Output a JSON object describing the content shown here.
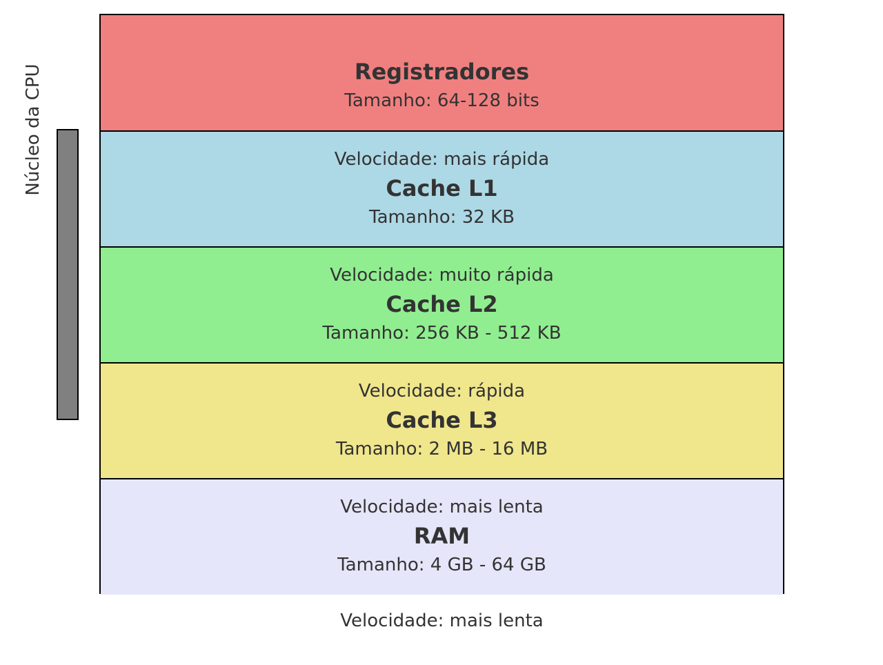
{
  "cpu_label": "Núcleo da CPU",
  "bottom_label": "Velocidade: mais lenta",
  "layers": [
    {
      "name": "Registradores",
      "speed": "",
      "size": "Tamanho: 64-128 bits",
      "color": "#f08080"
    },
    {
      "name": "Cache L1",
      "speed": "Velocidade: mais rápida",
      "size": "Tamanho: 32 KB",
      "color": "#add8e6"
    },
    {
      "name": "Cache L2",
      "speed": "Velocidade: muito rápida",
      "size": "Tamanho: 256 KB - 512 KB",
      "color": "#90ee90"
    },
    {
      "name": "Cache L3",
      "speed": "Velocidade: rápida",
      "size": "Tamanho: 2 MB - 16 MB",
      "color": "#f0e68c"
    },
    {
      "name": "RAM",
      "speed": "Velocidade: mais lenta",
      "size": "Tamanho: 4 GB - 64 GB",
      "color": "#e6e6fa"
    }
  ]
}
